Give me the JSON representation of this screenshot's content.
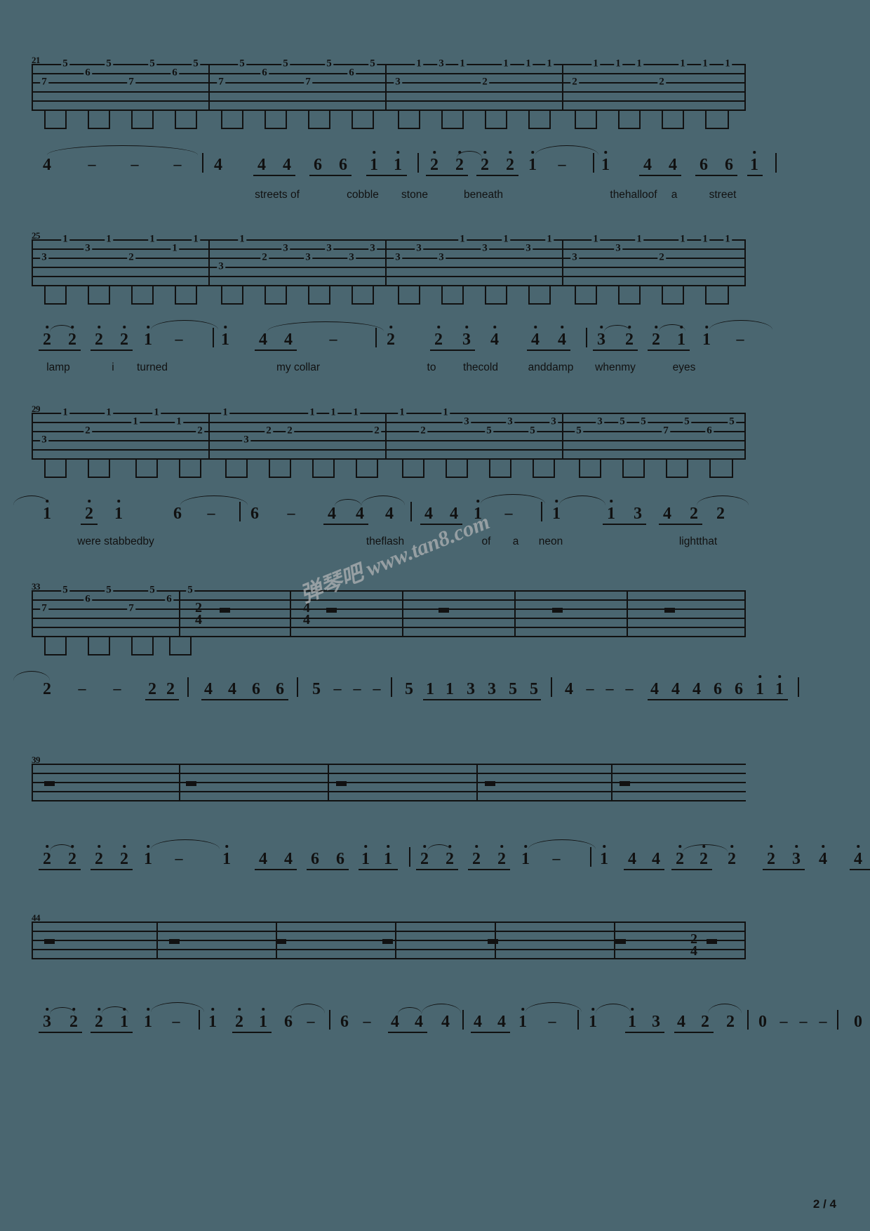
{
  "document": {
    "type": "guitar-tablature-with-jianpu",
    "page_label": "2 / 4",
    "watermark": "弹琴吧 www.tan8.com",
    "background_color": "#4a6670",
    "ink_color": "#111111"
  },
  "systems": [
    {
      "id": "system-21",
      "measure_number": "21",
      "tab_frets": [
        "5",
        "7",
        "6",
        "5",
        "7",
        "5",
        "6",
        "5",
        "7",
        "5",
        "6",
        "5",
        "7",
        "5",
        "6",
        "5"
      ],
      "melody": {
        "notes": [
          "4",
          "-",
          "-",
          "-",
          "4",
          "4",
          "4",
          "6",
          "6",
          "1",
          "1",
          "2",
          "2",
          "2",
          "2",
          "1",
          "-",
          "1",
          "4",
          "4",
          "6",
          "6",
          "1",
          "1"
        ],
        "barlines": 3
      },
      "lyrics": [
        "streets of",
        "cobble",
        "stone",
        "beneath",
        "thehalloof",
        "a",
        "street"
      ]
    },
    {
      "id": "system-25",
      "measure_number": "25",
      "tab_frets": [
        "1",
        "3",
        "1",
        "3",
        "2",
        "1",
        "1",
        "1",
        "3",
        "2",
        "1",
        "3",
        "3",
        "3",
        "1",
        "3",
        "3",
        "1",
        "3",
        "1",
        "3",
        "1",
        "3",
        "1",
        "3",
        "2",
        "1",
        "1"
      ],
      "melody": {
        "notes": [
          "2",
          "2",
          "2",
          "2",
          "1",
          "-",
          "1",
          "4",
          "4",
          "-",
          "2",
          "2",
          "3",
          "4",
          "4",
          "4",
          "3",
          "2",
          "2",
          "1",
          "1",
          "-"
        ],
        "barlines": 4
      },
      "lyrics": [
        "lamp",
        "i",
        "turned",
        "my collar",
        "to",
        "thecold",
        "anddamp",
        "whenmy",
        "eyes"
      ]
    },
    {
      "id": "system-29",
      "measure_number": "29",
      "tab_frets": [
        "1",
        "3",
        "1",
        "2",
        "1",
        "1",
        "1",
        "2",
        "1",
        "3",
        "1",
        "2",
        "2",
        "1",
        "1",
        "2",
        "1",
        "3",
        "5",
        "3",
        "5",
        "3",
        "5",
        "5",
        "5",
        "7",
        "6",
        "5"
      ],
      "melody": {
        "notes": [
          "1",
          "2",
          "1",
          "6",
          "-",
          "6",
          "-",
          "4",
          "4",
          "4",
          "4",
          "4",
          "1",
          "-",
          "1",
          "1",
          "3",
          "4",
          "2",
          "2"
        ],
        "barlines": 4
      },
      "lyrics": [
        "were stabbedby",
        "theflash",
        "of",
        "a",
        "neon",
        "lightthat"
      ]
    },
    {
      "id": "system-33",
      "measure_number": "33",
      "tab_frets": [
        "5",
        "7",
        "6",
        "5",
        "7",
        "5",
        "6",
        "5"
      ],
      "time_signatures": [
        "2/4",
        "4/4"
      ],
      "melody": {
        "notes": [
          "2",
          "-",
          "-",
          "2",
          "2",
          "4",
          "4",
          "6",
          "6",
          "5",
          "-",
          "-",
          "-",
          "5",
          "1",
          "1",
          "3",
          "3",
          "5",
          "5",
          "4",
          "-",
          "-",
          "-",
          "4",
          "4",
          "4",
          "6",
          "6",
          "1",
          "1"
        ],
        "barlines": 6
      },
      "lyrics": []
    },
    {
      "id": "system-39",
      "measure_number": "39",
      "tab_frets": [],
      "melody": {
        "notes": [
          "2",
          "2",
          "2",
          "2",
          "1",
          "-",
          "1",
          "4",
          "4",
          "6",
          "6",
          "1",
          "1",
          "2",
          "2",
          "2",
          "2",
          "1",
          "-",
          "1",
          "4",
          "4",
          "2",
          "2",
          "2",
          "2",
          "3",
          "4",
          "4",
          "4"
        ],
        "barlines": 4
      },
      "lyrics": []
    },
    {
      "id": "system-44",
      "measure_number": "44",
      "tab_frets": [],
      "time_signatures": [
        "2/4"
      ],
      "melody": {
        "notes": [
          "3",
          "2",
          "2",
          "1",
          "1",
          "-",
          "1",
          "2",
          "1",
          "6",
          "-",
          "6",
          "-",
          "4",
          "4",
          "4",
          "4",
          "4",
          "4",
          "1",
          "1",
          "3",
          "4",
          "2",
          "2",
          "0",
          "-",
          "-",
          "-",
          "0",
          "-"
        ],
        "barlines": 6
      },
      "lyrics": []
    }
  ]
}
